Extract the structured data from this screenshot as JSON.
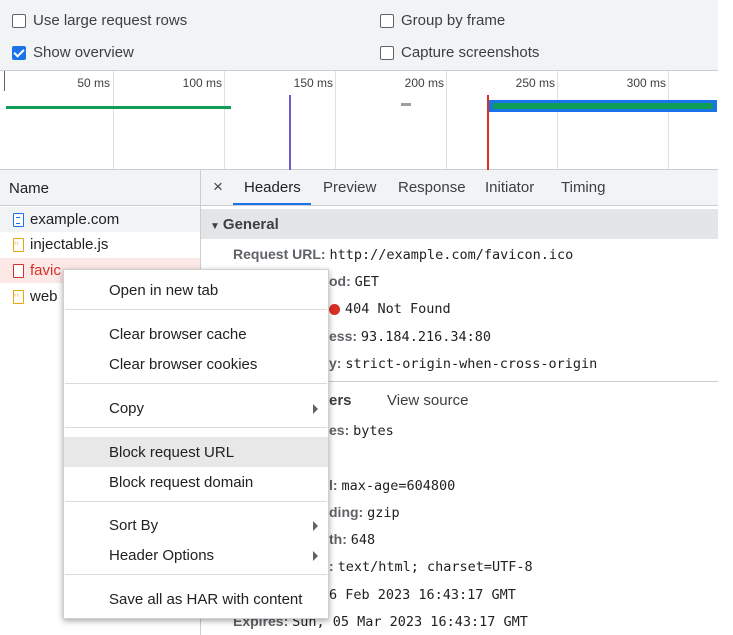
{
  "options": {
    "large_rows": {
      "label": "Use large request rows",
      "checked": false
    },
    "show_overview": {
      "label": "Show overview",
      "checked": true
    },
    "group_by_frame": {
      "label": "Group by frame",
      "checked": false
    },
    "capture_screenshots": {
      "label": "Capture screenshots",
      "checked": false
    }
  },
  "overview": {
    "ticks": [
      "50 ms",
      "100 ms",
      "150 ms",
      "200 ms",
      "250 ms",
      "300 ms"
    ]
  },
  "requests": {
    "header": "Name",
    "items": [
      {
        "name": "example.com",
        "type": "document"
      },
      {
        "name": "injectable.js",
        "type": "script"
      },
      {
        "name": "favic",
        "type": "error"
      },
      {
        "name": "web",
        "type": "script"
      }
    ]
  },
  "tabs": {
    "close": "×",
    "items": [
      "Headers",
      "Preview",
      "Response",
      "Initiator",
      "Timing"
    ],
    "active": "Headers"
  },
  "general": {
    "title": "General",
    "request_url_label": "Request URL:",
    "request_url": "http://example.com/favicon.ico",
    "method_label": "od:",
    "method": "GET",
    "status": "404 Not Found",
    "address_label": "ess:",
    "address": "93.184.216.34:80",
    "policy_label": "y:",
    "policy": "strict-origin-when-cross-origin"
  },
  "response_headers": {
    "title_frag": "ers",
    "view_source": "View source",
    "rows": [
      {
        "k": "es:",
        "v": "bytes"
      },
      {
        "k": "l:",
        "v": "max-age=604800"
      },
      {
        "k": "ding:",
        "v": "gzip"
      },
      {
        "k": "th:",
        "v": "648"
      },
      {
        "k": ":",
        "v": "text/html; charset=UTF-8"
      },
      {
        "k": "",
        "v": "6 Feb 2023 16:43:17 GMT"
      },
      {
        "k": "Expires:",
        "v": "Sun, 05 Mar 2023 16:43:17 GMT"
      }
    ]
  },
  "context_menu": {
    "items": [
      "Open in new tab",
      "Clear browser cache",
      "Clear browser cookies",
      "Copy",
      "Block request URL",
      "Block request domain",
      "Sort By",
      "Header Options",
      "Save all as HAR with content"
    ]
  },
  "colors": {
    "accent": "#1a73e8",
    "error": "#d93025",
    "error_row_bg": "#fce8e6",
    "green_bar": "#0f9d58"
  }
}
